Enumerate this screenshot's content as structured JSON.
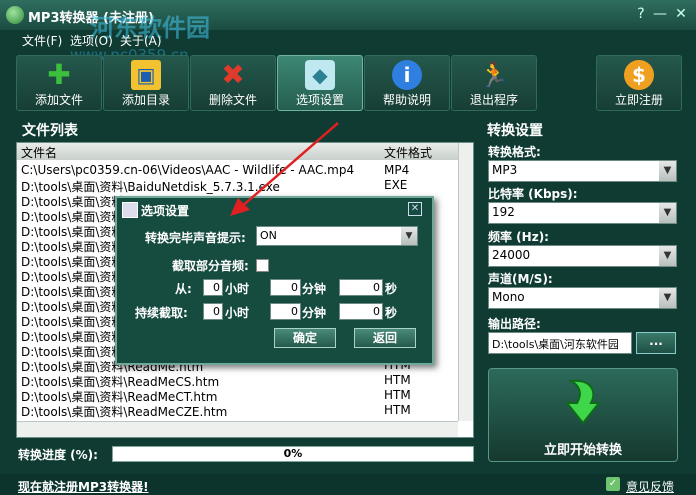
{
  "window": {
    "title": "MP3转换器 (未注册)",
    "help": "?",
    "minimize": "—",
    "close": "✕"
  },
  "watermark": {
    "text1": "河东软件园",
    "text2": "www.pc0359.cn"
  },
  "menu": [
    "文件(F)",
    "选项(O)",
    "关于(A)"
  ],
  "toolbar": [
    {
      "label": "添加文件",
      "icon": "add-icon",
      "color": "#3cbf3c"
    },
    {
      "label": "添加目录",
      "icon": "folder-icon",
      "color": "#f2c230"
    },
    {
      "label": "删除文件",
      "icon": "delete-icon",
      "color": "#e03a2a"
    },
    {
      "label": "选项设置",
      "icon": "options-icon",
      "color": "#7fd4e6"
    },
    {
      "label": "帮助说明",
      "icon": "info-icon",
      "color": "#2f7fe0"
    },
    {
      "label": "退出程序",
      "icon": "exit-icon",
      "color": "#f0c020"
    },
    {
      "label": "立即注册",
      "icon": "dollar-icon",
      "color": "#f0a020"
    }
  ],
  "file_list": {
    "title": "文件列表",
    "columns": [
      "文件名",
      "文件格式"
    ],
    "rows": [
      {
        "name": "C:\\Users\\pc0359.cn-06\\Videos\\AAC - Wildlife - AAC.mp4",
        "format": "MP4"
      },
      {
        "name": "D:\\tools\\桌面\\资料\\BaiduNetdisk_5.7.3.1.exe",
        "format": "EXE"
      },
      {
        "name": "D:\\tools\\桌面\\资料",
        "format": ""
      },
      {
        "name": "D:\\tools\\桌面\\资料",
        "format": ""
      },
      {
        "name": "D:\\tools\\桌面\\资料",
        "format": ""
      },
      {
        "name": "D:\\tools\\桌面\\资料",
        "format": ""
      },
      {
        "name": "D:\\tools\\桌面\\资料",
        "format": ""
      },
      {
        "name": "D:\\tools\\桌面\\资料",
        "format": ""
      },
      {
        "name": "D:\\tools\\桌面\\资料",
        "format": ""
      },
      {
        "name": "D:\\tools\\桌面\\资料",
        "format": ""
      },
      {
        "name": "D:\\tools\\桌面\\资料",
        "format": ""
      },
      {
        "name": "D:\\tools\\桌面\\资料",
        "format": ""
      },
      {
        "name": "D:\\tools\\桌面\\资料",
        "format": ""
      },
      {
        "name": "D:\\tools\\桌面\\资料\\ReadMe.htm",
        "format": "HTM"
      },
      {
        "name": "D:\\tools\\桌面\\资料\\ReadMeCS.htm",
        "format": "HTM"
      },
      {
        "name": "D:\\tools\\桌面\\资料\\ReadMeCT.htm",
        "format": "HTM"
      },
      {
        "name": "D:\\tools\\桌面\\资料\\ReadMeCZE.htm",
        "format": "HTM"
      }
    ]
  },
  "progress": {
    "label": "转换进度 (%):",
    "value": 0,
    "text": "0%"
  },
  "settings": {
    "title": "转换设置",
    "format_label": "转换格式:",
    "format_value": "MP3",
    "bitrate_label": "比特率 (Kbps):",
    "bitrate_value": "192",
    "freq_label": "频率 (Hz):",
    "freq_value": "24000",
    "channel_label": "声道(M/S):",
    "channel_value": "Mono",
    "output_label": "输出路径:",
    "output_value": "D:\\tools\\桌面\\河东软件园",
    "browse": "...",
    "start": "立即开始转换"
  },
  "dialog": {
    "title": "选项设置",
    "sound_label": "转换完毕声音提示:",
    "sound_value": "ON",
    "partial_label": "截取部分音频:",
    "from_label": "从:",
    "duration_label": "持续截取:",
    "hour_unit": "小时",
    "min_unit": "分钟",
    "sec_unit": "秒",
    "from": {
      "h": "0",
      "m": "0",
      "s": "0"
    },
    "dur": {
      "h": "0",
      "m": "0",
      "s": "0"
    },
    "ok": "确定",
    "back": "返回"
  },
  "status": {
    "register": "现在就注册MP3转换器!",
    "feedback": "意见反馈"
  }
}
